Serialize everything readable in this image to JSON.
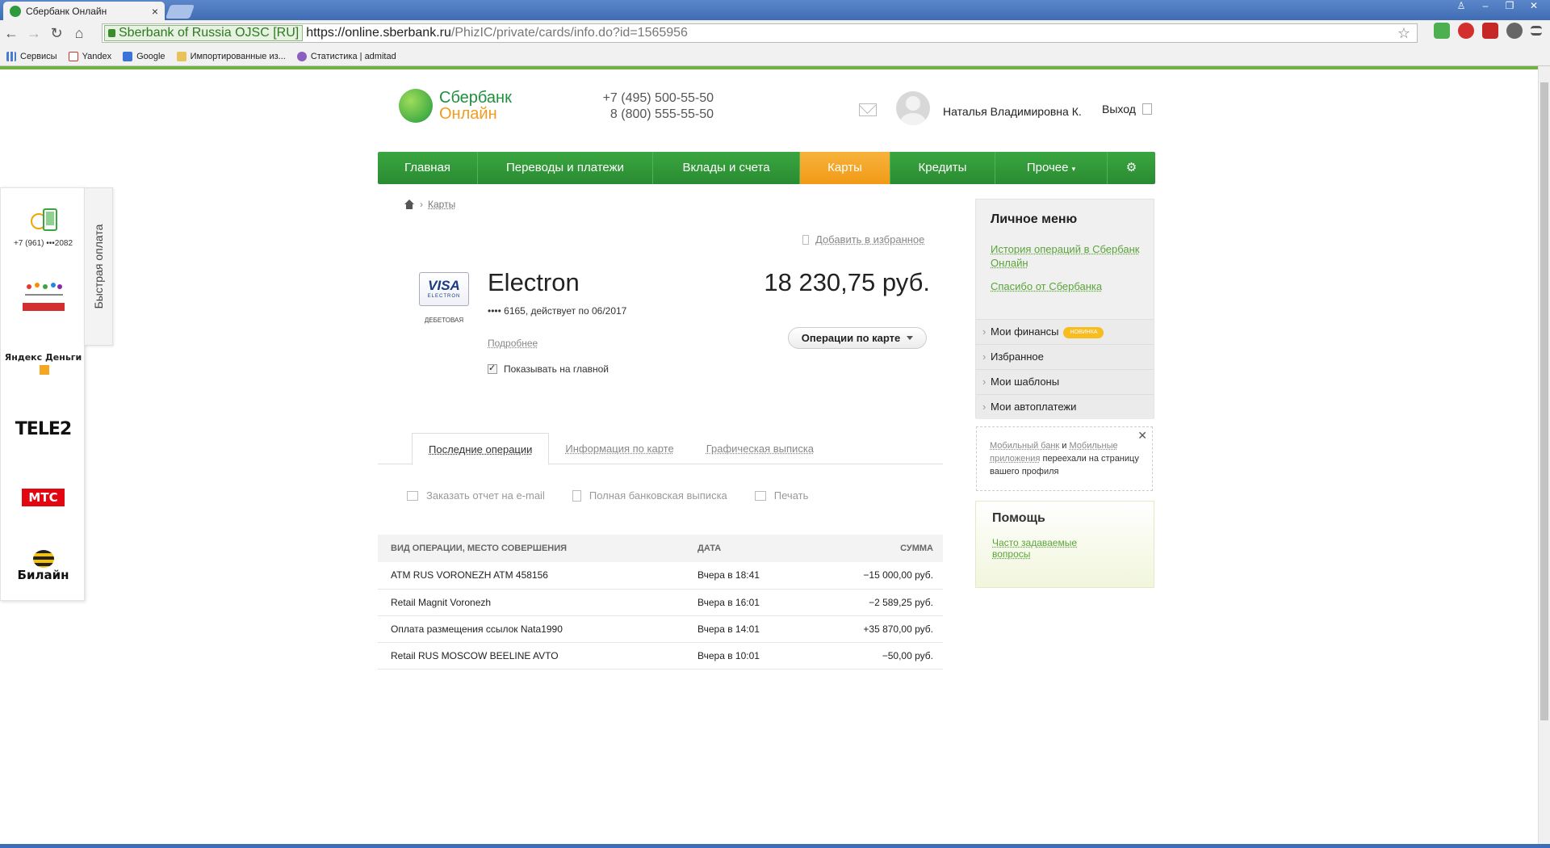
{
  "browser": {
    "tab_title": "Сбербанк Онлайн",
    "ev_label": "Sberbank of Russia OJSC [RU]",
    "url_scheme_host": "https://online.sberbank.ru",
    "url_path": "/PhizIC/private/cards/info.do?id=1565956",
    "bookmarks": [
      "Сервисы",
      "Yandex",
      "Google",
      "Импортированные из...",
      "Статистика | admitad"
    ]
  },
  "quickpay": {
    "tab_label": "Быстрая оплата",
    "phone": "+7 (961) •••2082",
    "providers": [
      "Яндекс Деньги",
      "TELE2",
      "МТС",
      "Билайн"
    ]
  },
  "header": {
    "logo_line1": "Сбербанк",
    "logo_line2": "Онлайн",
    "phone1": "+7 (495) 500-55-50",
    "phone2": "8 (800) 555-55-50",
    "user_name": "Наталья Владимировна К.",
    "logout": "Выход"
  },
  "nav": {
    "items": [
      "Главная",
      "Переводы и платежи",
      "Вклады и счета",
      "Карты",
      "Кредиты",
      "Прочее"
    ],
    "active": "Карты",
    "accent": "#f29a17",
    "brand": "#2a8b32"
  },
  "breadcrumb": {
    "current": "Карты"
  },
  "favorites_link": "Добавить в избранное",
  "card": {
    "brand": "VISA",
    "brand_sub": "ELECTRON",
    "kind": "ДЕБЕТОВАЯ",
    "name": "Electron",
    "info": "•••• 6165, действует по 06/2017",
    "balance": "18 230,75 руб.",
    "details": "Подробнее",
    "show_on_main": "Показывать на главной",
    "operations_button": "Операции по карте"
  },
  "tabs": {
    "items": [
      "Последние операции",
      "Информация по карте",
      "Графическая выписка"
    ],
    "active_index": 0
  },
  "actions": [
    "Заказать отчет на e-mail",
    "Полная банковская выписка",
    "Печать"
  ],
  "table": {
    "headers": [
      "ВИД ОПЕРАЦИИ, МЕСТО СОВЕРШЕНИЯ",
      "ДАТА",
      "СУММА"
    ],
    "rows": [
      {
        "op": "ATM RUS VORONEZH ATM 458156",
        "date": "Вчера в 18:41",
        "amount": "−15 000,00 руб."
      },
      {
        "op": "Retail Magnit Voronezh",
        "date": "Вчера в 16:01",
        "amount": "−2 589,25 руб."
      },
      {
        "op": "Оплата размещения ссылок Nata1990",
        "date": "Вчера в 14:01",
        "amount": "+35 870,00 руб."
      },
      {
        "op": "Retail RUS MOSCOW BEELINE AVTO",
        "date": "Вчера в 10:01",
        "amount": "−50,00 руб."
      }
    ]
  },
  "personal_menu": {
    "title": "Личное меню",
    "link1": "История операций в Сбербанк Онлайн",
    "link2": "Спасибо от Сбербанка",
    "items": [
      "Мои финансы",
      "Избранное",
      "Мои шаблоны",
      "Мои автоплатежи"
    ],
    "badge": "НОВИНКА"
  },
  "notice": {
    "link1": "Мобильный банк",
    "and": "и",
    "link2": "Мобильные приложения",
    "rest": "переехали на страницу вашего профиля"
  },
  "help": {
    "title": "Помощь",
    "link": "Часто задаваемые вопросы"
  }
}
